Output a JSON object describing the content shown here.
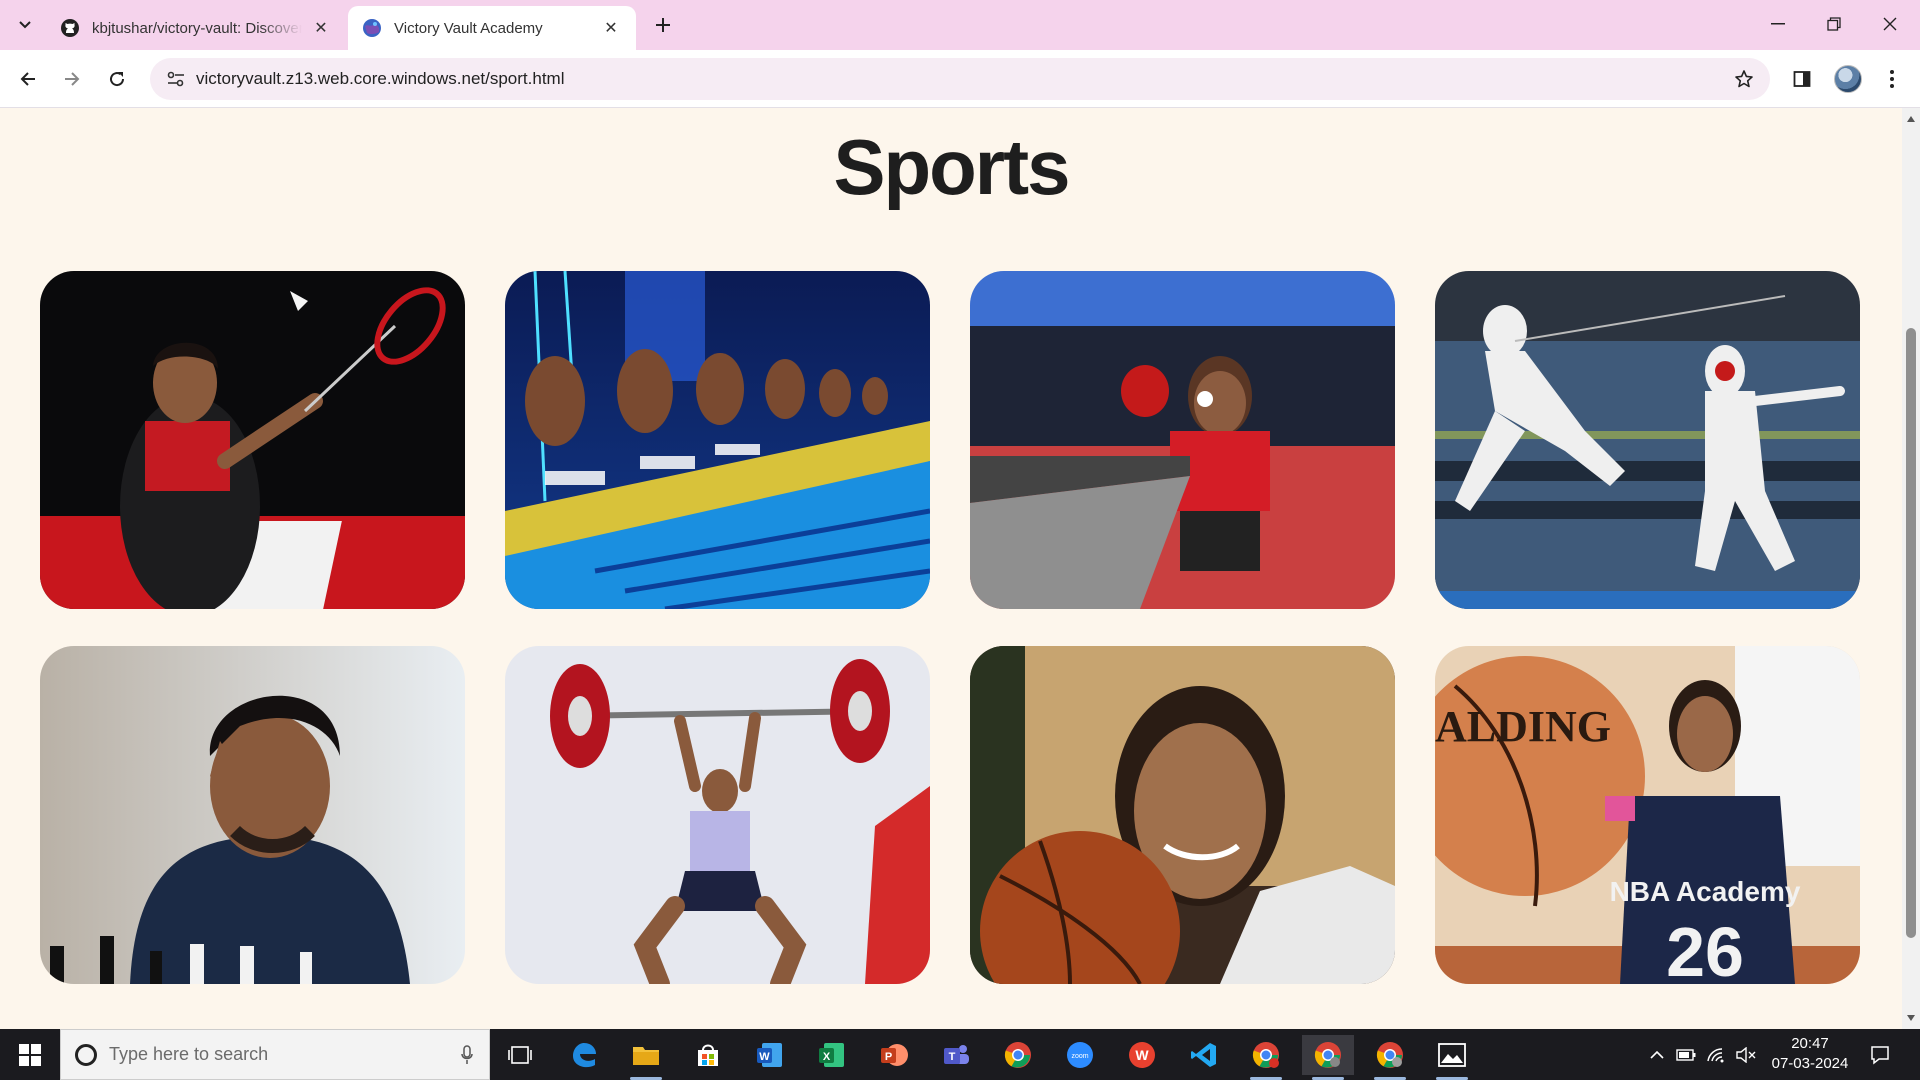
{
  "browser": {
    "tabs": [
      {
        "title": "kbjtushar/victory-vault: Discover",
        "favicon": "github-icon",
        "active": false
      },
      {
        "title": "Victory Vault Academy",
        "favicon": "site-globe-icon",
        "active": true
      }
    ],
    "address": "victoryvault.z13.web.core.windows.net/sport.html"
  },
  "page": {
    "title": "Sports",
    "cards": [
      {
        "subject": "badminton",
        "icon": "badminton-player-photo"
      },
      {
        "subject": "swimming",
        "icon": "swimmers-start-photo"
      },
      {
        "subject": "table tennis",
        "icon": "table-tennis-player-photo"
      },
      {
        "subject": "fencing",
        "icon": "fencers-photo"
      },
      {
        "subject": "chess",
        "icon": "chess-player-photo"
      },
      {
        "subject": "weightlifting",
        "icon": "weightlifter-photo"
      },
      {
        "subject": "basketball",
        "icon": "basketball-player-photo"
      },
      {
        "subject": "basketball",
        "icon": "nba-academy-player-photo"
      }
    ],
    "jersey_text": "NBA Academy",
    "jersey_number": "26",
    "ball_brand": "ALDING"
  },
  "taskbar": {
    "search_placeholder": "Type here to search",
    "time": "20:47",
    "date": "07-03-2024",
    "pinned": [
      "task-view-icon",
      "edge-icon",
      "file-explorer-icon",
      "store-icon",
      "word-icon",
      "excel-icon",
      "powerpoint-icon",
      "teams-icon",
      "chrome-icon",
      "zoom-icon",
      "wps-icon",
      "vscode-icon",
      "chrome-profile-icon",
      "chrome-active-icon",
      "chrome-alt-icon",
      "photos-icon"
    ]
  },
  "colors": {
    "tab_strip": "#f5d3ec",
    "page_background": "#fdf6ec",
    "title_text": "#1e1e1e",
    "taskbar": "#1b1b1f"
  }
}
